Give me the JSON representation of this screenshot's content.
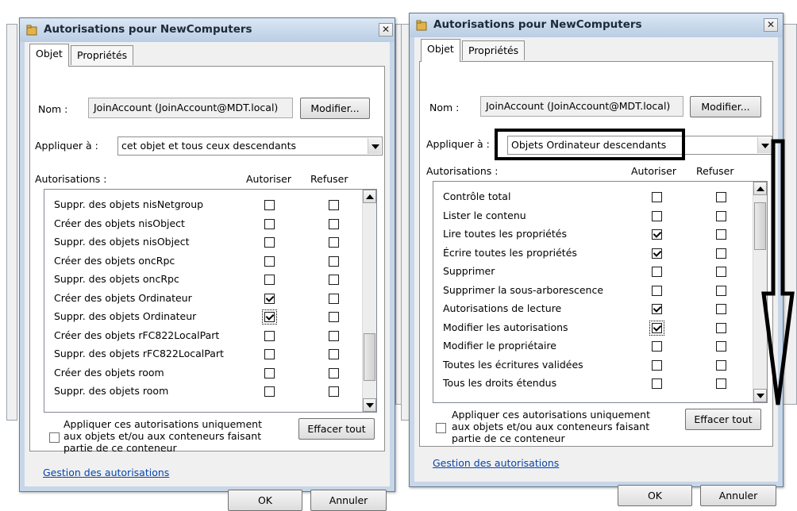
{
  "dialogs": [
    {
      "title": "Autorisations pour NewComputers",
      "close_label": "✕",
      "tabs": [
        "Objet",
        "Propriétés"
      ],
      "name_label": "Nom :",
      "name_value": "JoinAccount (JoinAccount@MDT.local)",
      "modify_button": "Modifier...",
      "apply_to_label": "Appliquer à :",
      "apply_to_value": "cet objet et tous ceux descendants",
      "perms_label": "Autorisations :",
      "col_allow": "Autoriser",
      "col_deny": "Refuser",
      "rows": [
        {
          "name": "Suppr. des objets nisNetgroup",
          "allow": false,
          "deny": false
        },
        {
          "name": "Créer des objets nisObject",
          "allow": false,
          "deny": false
        },
        {
          "name": "Suppr. des objets nisObject",
          "allow": false,
          "deny": false
        },
        {
          "name": "Créer des objets oncRpc",
          "allow": false,
          "deny": false
        },
        {
          "name": "Suppr. des objets oncRpc",
          "allow": false,
          "deny": false
        },
        {
          "name": "Créer des objets Ordinateur",
          "allow": true,
          "deny": false
        },
        {
          "name": "Suppr. des objets Ordinateur",
          "allow": true,
          "deny": false,
          "focus": true
        },
        {
          "name": "Créer des objets rFC822LocalPart",
          "allow": false,
          "deny": false
        },
        {
          "name": "Suppr. des objets rFC822LocalPart",
          "allow": false,
          "deny": false
        },
        {
          "name": "Créer des objets room",
          "allow": false,
          "deny": false
        },
        {
          "name": "Suppr. des objets room",
          "allow": false,
          "deny": false
        }
      ],
      "apply_only_text": "Appliquer ces autorisations uniquement aux objets et/ou aux conteneurs faisant partie de ce conteneur",
      "apply_only_checked": false,
      "clear_all_button": "Effacer tout",
      "manage_link": "Gestion des autorisations",
      "ok_button": "OK",
      "cancel_button": "Annuler",
      "scroll_thumb_position": 0.88
    },
    {
      "title": "Autorisations pour NewComputers",
      "close_label": "✕",
      "tabs": [
        "Objet",
        "Propriétés"
      ],
      "name_label": "Nom :",
      "name_value": "JoinAccount (JoinAccount@MDT.local)",
      "modify_button": "Modifier...",
      "apply_to_label": "Appliquer à :",
      "apply_to_value": "Objets Ordinateur descendants",
      "perms_label": "Autorisations :",
      "col_allow": "Autoriser",
      "col_deny": "Refuser",
      "rows": [
        {
          "name": "Contrôle total",
          "allow": false,
          "deny": false
        },
        {
          "name": "Lister le contenu",
          "allow": false,
          "deny": false
        },
        {
          "name": "Lire toutes les propriétés",
          "allow": true,
          "deny": false
        },
        {
          "name": "Écrire toutes les propriétés",
          "allow": true,
          "deny": false
        },
        {
          "name": "Supprimer",
          "allow": false,
          "deny": false
        },
        {
          "name": "Supprimer la sous-arborescence",
          "allow": false,
          "deny": false
        },
        {
          "name": "Autorisations de lecture",
          "allow": true,
          "deny": false
        },
        {
          "name": "Modifier les autorisations",
          "allow": true,
          "deny": false,
          "focus": true
        },
        {
          "name": "Modifier le propriétaire",
          "allow": false,
          "deny": false
        },
        {
          "name": "Toutes les écritures validées",
          "allow": false,
          "deny": false
        },
        {
          "name": "Tous les droits étendus",
          "allow": false,
          "deny": false
        }
      ],
      "apply_only_text": "Appliquer ces autorisations uniquement aux objets et/ou aux conteneurs faisant partie de ce conteneur",
      "apply_only_checked": false,
      "clear_all_button": "Effacer tout",
      "manage_link": "Gestion des autorisations",
      "ok_button": "OK",
      "cancel_button": "Annuler",
      "scroll_thumb_position": 0.05
    }
  ],
  "annotation_color": "#000000",
  "icons": {
    "title_icon": "folder-key-icon",
    "down_arrow": "down-arrow-annotation-icon"
  }
}
